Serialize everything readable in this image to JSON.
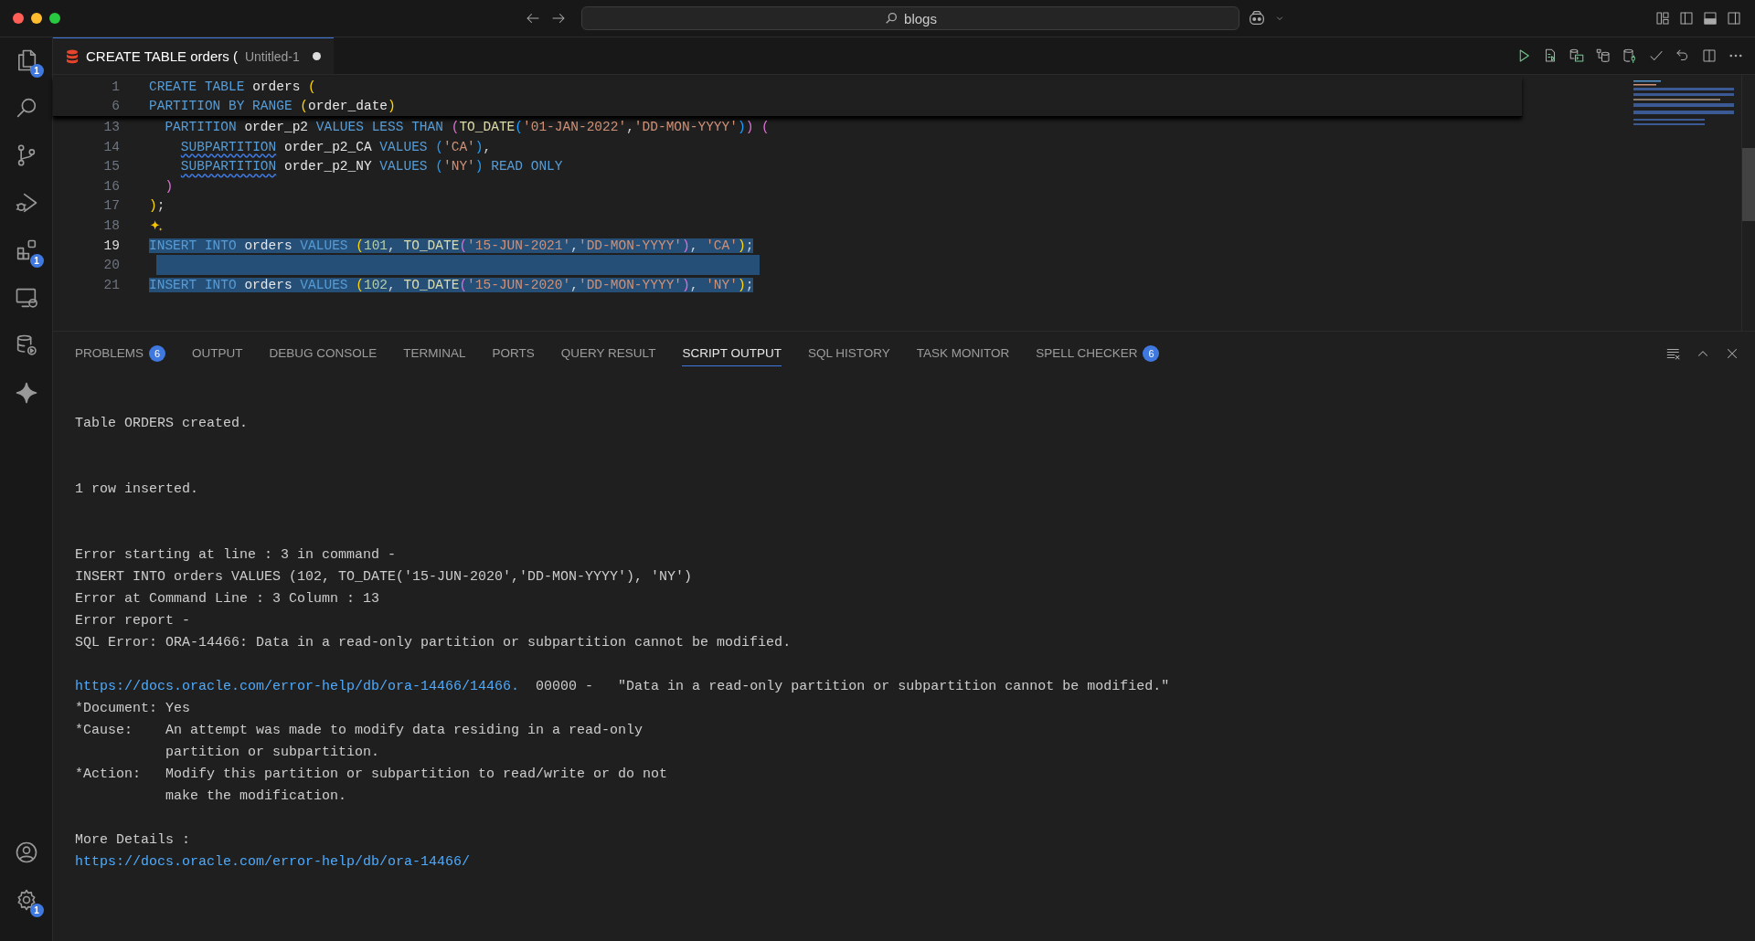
{
  "title_bar": {
    "search": "blogs"
  },
  "activity_bar": {
    "items": [
      {
        "kind": "files",
        "badge": "1",
        "selected": false
      },
      {
        "kind": "search",
        "selected": false
      },
      {
        "kind": "source-control",
        "selected": false
      },
      {
        "kind": "run-debug",
        "selected": false
      },
      {
        "kind": "extensions",
        "badge": "1",
        "selected": false
      },
      {
        "kind": "remote",
        "selected": false
      },
      {
        "kind": "database",
        "selected": false
      },
      {
        "kind": "sparkle",
        "selected": false
      }
    ],
    "bottom": [
      {
        "kind": "account"
      },
      {
        "kind": "settings",
        "badge": "1"
      }
    ]
  },
  "editor": {
    "tab": {
      "title": "CREATE TABLE orders (",
      "subtitle": "Untitled-1",
      "dirty": true
    },
    "sticky_lines": [
      {
        "number": "1",
        "tokens": [
          {
            "kind": "kw",
            "text": "CREATE TABLE "
          },
          {
            "kind": "id",
            "text": "orders "
          },
          {
            "kind": "p1",
            "text": "("
          }
        ]
      },
      {
        "number": "6",
        "tokens": [
          {
            "kind": "kw",
            "text": "PARTITION BY RANGE "
          },
          {
            "kind": "p1",
            "text": "("
          },
          {
            "kind": "id",
            "text": "order_date"
          },
          {
            "kind": "p1",
            "text": ")"
          }
        ]
      }
    ],
    "lines": [
      {
        "number": "13",
        "current": false,
        "selected": false,
        "tokens": [
          {
            "kind": "kw",
            "text": "  PARTITION "
          },
          {
            "kind": "id",
            "text": "order_p2 "
          },
          {
            "kind": "kw",
            "text": "VALUES LESS THAN "
          },
          {
            "kind": "p2",
            "text": "("
          },
          {
            "kind": "fn",
            "text": "TO_DATE"
          },
          {
            "kind": "p3",
            "text": "("
          },
          {
            "kind": "str",
            "text": "'01-JAN-2022'"
          },
          {
            "kind": "punc",
            "text": ","
          },
          {
            "kind": "str",
            "text": "'DD-MON-YYYY'"
          },
          {
            "kind": "p3",
            "text": ")"
          },
          {
            "kind": "p2",
            "text": ") ("
          }
        ]
      },
      {
        "number": "14",
        "current": false,
        "selected": false,
        "tokens": [
          {
            "kind": "squiggle",
            "text": "    SUBPARTITION"
          },
          {
            "kind": "id",
            "text": " order_p2_CA "
          },
          {
            "kind": "kw",
            "text": "VALUES "
          },
          {
            "kind": "p3",
            "text": "("
          },
          {
            "kind": "str",
            "text": "'CA'"
          },
          {
            "kind": "p3",
            "text": ")"
          },
          {
            "kind": "punc",
            "text": ","
          }
        ]
      },
      {
        "number": "15",
        "current": false,
        "selected": false,
        "tokens": [
          {
            "kind": "squiggle",
            "text": "    SUBPARTITION"
          },
          {
            "kind": "id",
            "text": " order_p2_NY "
          },
          {
            "kind": "kw",
            "text": "VALUES "
          },
          {
            "kind": "p3",
            "text": "("
          },
          {
            "kind": "str",
            "text": "'NY'"
          },
          {
            "kind": "p3",
            "text": ")"
          },
          {
            "kind": "kw",
            "text": " READ ONLY"
          }
        ]
      },
      {
        "number": "16",
        "current": false,
        "selected": false,
        "tokens": [
          {
            "kind": "p2",
            "text": "  )"
          }
        ]
      },
      {
        "number": "17",
        "current": false,
        "selected": false,
        "tokens": [
          {
            "kind": "p1",
            "text": ")"
          },
          {
            "kind": "punc",
            "text": ";"
          }
        ]
      },
      {
        "number": "18",
        "current": false,
        "selected": false,
        "hint": true
      },
      {
        "number": "19",
        "current": true,
        "selected": true,
        "tokens": [
          {
            "kind": "kw",
            "text": "INSERT INTO "
          },
          {
            "kind": "id",
            "text": "orders "
          },
          {
            "kind": "kw",
            "text": "VALUES "
          },
          {
            "kind": "p1",
            "text": "("
          },
          {
            "kind": "num",
            "text": "101"
          },
          {
            "kind": "punc",
            "text": ", "
          },
          {
            "kind": "fn",
            "text": "TO_DATE"
          },
          {
            "kind": "p2",
            "text": "("
          },
          {
            "kind": "str",
            "text": "'15-JUN-2021'"
          },
          {
            "kind": "punc",
            "text": ","
          },
          {
            "kind": "str",
            "text": "'DD-MON-YYYY'"
          },
          {
            "kind": "p2",
            "text": ")"
          },
          {
            "kind": "punc",
            "text": ", "
          },
          {
            "kind": "str",
            "text": "'CA'"
          },
          {
            "kind": "p1",
            "text": ")"
          },
          {
            "kind": "punc",
            "text": ";"
          }
        ]
      },
      {
        "number": "20",
        "current": false,
        "selected": true
      },
      {
        "number": "21",
        "current": false,
        "selected": true,
        "tokens": [
          {
            "kind": "kw",
            "text": "INSERT INTO "
          },
          {
            "kind": "id",
            "text": "orders "
          },
          {
            "kind": "kw",
            "text": "VALUES "
          },
          {
            "kind": "p1",
            "text": "("
          },
          {
            "kind": "num",
            "text": "102"
          },
          {
            "kind": "punc",
            "text": ", "
          },
          {
            "kind": "fn",
            "text": "TO_DATE"
          },
          {
            "kind": "p2",
            "text": "("
          },
          {
            "kind": "str",
            "text": "'15-JUN-2020'"
          },
          {
            "kind": "punc",
            "text": ","
          },
          {
            "kind": "str",
            "text": "'DD-MON-YYYY'"
          },
          {
            "kind": "p2",
            "text": ")"
          },
          {
            "kind": "punc",
            "text": ", "
          },
          {
            "kind": "str",
            "text": "'NY'"
          },
          {
            "kind": "p1",
            "text": ")"
          },
          {
            "kind": "punc",
            "text": ";"
          }
        ]
      }
    ]
  },
  "panel": {
    "tabs": [
      {
        "label": "PROBLEMS",
        "count": "6",
        "selected": false
      },
      {
        "label": "OUTPUT",
        "selected": false
      },
      {
        "label": "DEBUG CONSOLE",
        "selected": false
      },
      {
        "label": "TERMINAL",
        "selected": false
      },
      {
        "label": "PORTS",
        "selected": false
      },
      {
        "label": "QUERY RESULT",
        "selected": false
      },
      {
        "label": "SCRIPT OUTPUT",
        "selected": true
      },
      {
        "label": "SQL HISTORY",
        "selected": false
      },
      {
        "label": "TASK MONITOR",
        "selected": false
      },
      {
        "label": "SPELL CHECKER",
        "count": "6",
        "selected": false
      }
    ],
    "output": [
      {
        "kind": "text",
        "parts": [
          {
            "kind": "text",
            "text": "Table ORDERS created."
          }
        ]
      },
      {
        "kind": "blank"
      },
      {
        "kind": "blank"
      },
      {
        "kind": "text",
        "parts": [
          {
            "kind": "text",
            "text": "1 row inserted."
          }
        ]
      },
      {
        "kind": "blank"
      },
      {
        "kind": "blank"
      },
      {
        "kind": "text",
        "parts": [
          {
            "kind": "text",
            "text": "Error starting at line : 3 in command -"
          }
        ]
      },
      {
        "kind": "text",
        "parts": [
          {
            "kind": "text",
            "text": "INSERT INTO orders VALUES (102, TO_DATE('15-JUN-2020','DD-MON-YYYY'), 'NY')"
          }
        ]
      },
      {
        "kind": "text",
        "parts": [
          {
            "kind": "text",
            "text": "Error at Command Line : 3 Column : 13"
          }
        ]
      },
      {
        "kind": "text",
        "parts": [
          {
            "kind": "text",
            "text": "Error report -"
          }
        ]
      },
      {
        "kind": "text",
        "parts": [
          {
            "kind": "text",
            "text": "SQL Error: ORA-14466: Data in a read-only partition or subpartition cannot be modified."
          }
        ]
      },
      {
        "kind": "blank"
      },
      {
        "kind": "text",
        "parts": [
          {
            "kind": "link",
            "text": "https://docs.oracle.com/error-help/db/ora-14466/14466."
          },
          {
            "kind": "text",
            "text": "  00000 -   \"Data in a read-only partition or subpartition cannot be modified.\""
          }
        ]
      },
      {
        "kind": "text",
        "parts": [
          {
            "kind": "text",
            "text": "*Document: Yes"
          }
        ]
      },
      {
        "kind": "text",
        "parts": [
          {
            "kind": "text",
            "text": "*Cause:    An attempt was made to modify data residing in a read-only"
          }
        ]
      },
      {
        "kind": "text",
        "parts": [
          {
            "kind": "text",
            "text": "           partition or subpartition."
          }
        ]
      },
      {
        "kind": "text",
        "parts": [
          {
            "kind": "text",
            "text": "*Action:   Modify this partition or subpartition to read/write or do not"
          }
        ]
      },
      {
        "kind": "text",
        "parts": [
          {
            "kind": "text",
            "text": "           make the modification."
          }
        ]
      },
      {
        "kind": "blank"
      },
      {
        "kind": "text",
        "parts": [
          {
            "kind": "text",
            "text": "More Details :"
          }
        ]
      },
      {
        "kind": "text",
        "parts": [
          {
            "kind": "link",
            "text": "https://docs.oracle.com/error-help/db/ora-14466/"
          }
        ]
      }
    ]
  }
}
